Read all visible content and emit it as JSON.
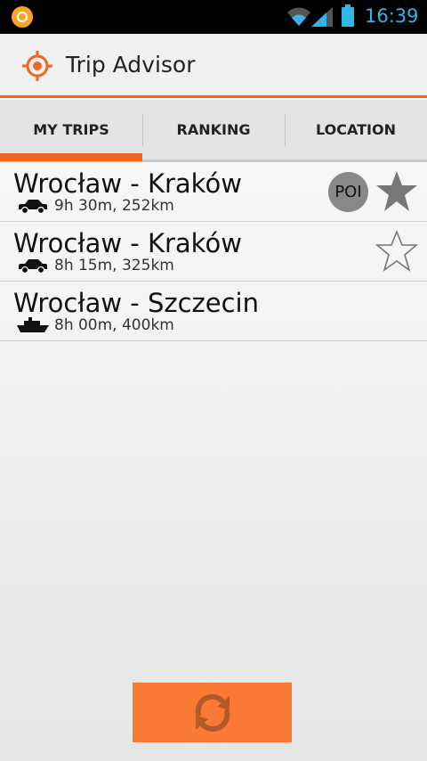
{
  "status_bar": {
    "time": "16:39",
    "app_icon": "notification-app-icon",
    "icons": [
      "wifi-icon",
      "signal-icon",
      "battery-icon"
    ]
  },
  "action_bar": {
    "title": "Trip Advisor",
    "logo_icon": "crosshair-target-icon"
  },
  "tabs": [
    {
      "label": "MY TRIPS",
      "selected": true
    },
    {
      "label": "RANKING",
      "selected": false
    },
    {
      "label": "LOCATION",
      "selected": false
    }
  ],
  "trips": [
    {
      "title": "Wrocław - Kraków",
      "subtitle": "9h 30m, 252km",
      "vehicle": "car-icon",
      "poi": "POI",
      "starred": true
    },
    {
      "title": "Wrocław - Kraków",
      "subtitle": "8h 15m, 325km",
      "vehicle": "car-icon",
      "starred": false
    },
    {
      "title": "Wrocław - Szczecin",
      "subtitle": "8h 00m, 400km",
      "vehicle": "ship-icon"
    }
  ],
  "refresh_button": {
    "icon": "refresh-icon"
  },
  "colors": {
    "accent": "#f26522",
    "button": "#f97a34",
    "status_text": "#33b5e5",
    "star_filled": "#777777"
  }
}
